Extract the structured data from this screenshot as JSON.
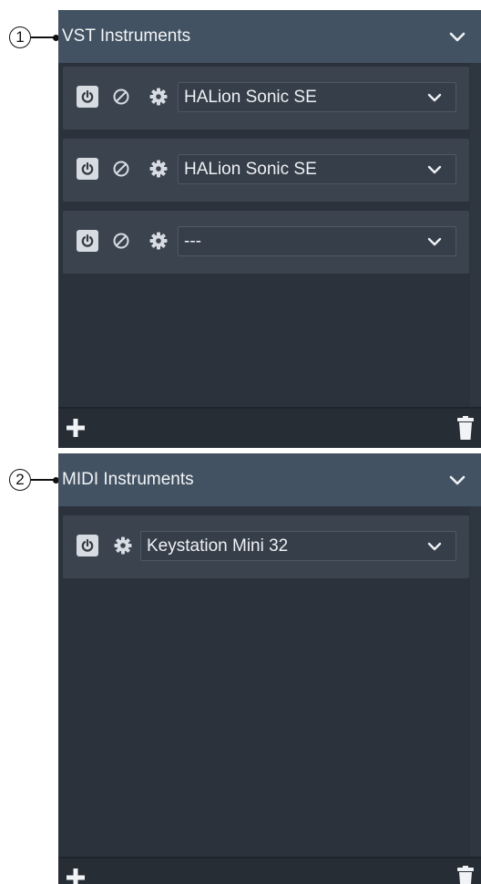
{
  "callouts": [
    "1",
    "2"
  ],
  "vst_panel": {
    "title": "VST Instruments",
    "instruments": [
      {
        "name": "HALion Sonic SE"
      },
      {
        "name": "HALion Sonic SE"
      },
      {
        "name": "---"
      }
    ]
  },
  "midi_panel": {
    "title": "MIDI Instruments",
    "instruments": [
      {
        "name": "Keystation Mini 32"
      }
    ]
  },
  "colors": {
    "panel_bg": "#2b323c",
    "header_bg": "#435262",
    "card_bg": "#3a434e",
    "text": "#eef1f4"
  },
  "icons": [
    "power-icon",
    "bypass-icon",
    "gear-icon",
    "chevron-down-icon",
    "plus-icon",
    "trash-icon"
  ]
}
